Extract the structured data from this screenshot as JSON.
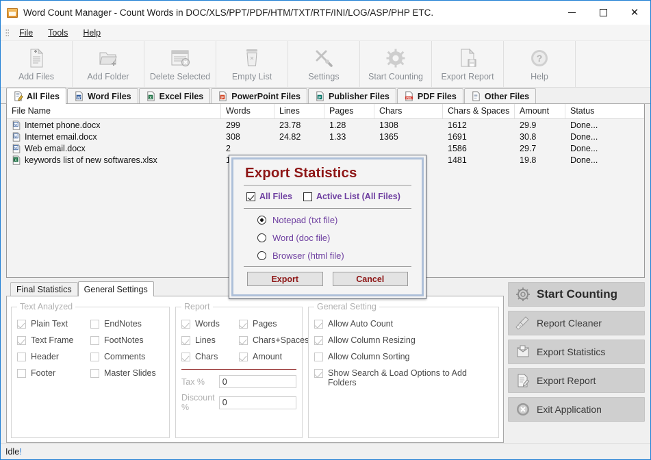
{
  "window": {
    "title": "Word Count Manager - Count Words in DOC/XLS/PPT/PDF/HTM/TXT/RTF/INI/LOG/ASP/PHP ETC.",
    "app_icon": "app-icon",
    "minimize": "–",
    "maximize": "□",
    "close": "✕"
  },
  "menu": {
    "items": [
      {
        "label": "File"
      },
      {
        "label": "Tools"
      },
      {
        "label": "Help"
      }
    ]
  },
  "toolbar": {
    "items": [
      {
        "label": "Add Files",
        "icon": "add-file-icon"
      },
      {
        "label": "Add Folder",
        "icon": "add-folder-icon"
      },
      {
        "label": "Delete Selected",
        "icon": "delete-selected-icon"
      },
      {
        "label": "Empty List",
        "icon": "trash-icon"
      },
      {
        "label": "Settings",
        "icon": "tools-icon"
      },
      {
        "label": "Start Counting",
        "icon": "gear-icon"
      },
      {
        "label": "Export Report",
        "icon": "save-document-icon"
      },
      {
        "label": "Help",
        "icon": "question-icon"
      }
    ]
  },
  "tabs": [
    {
      "label": "All Files",
      "icon": "pencil-note-icon",
      "active": true
    },
    {
      "label": "Word Files",
      "icon": "word-icon",
      "active": false
    },
    {
      "label": "Excel Files",
      "icon": "excel-icon",
      "active": false
    },
    {
      "label": "PowerPoint Files",
      "icon": "powerpoint-icon",
      "active": false
    },
    {
      "label": "Publisher Files",
      "icon": "publisher-icon",
      "active": false
    },
    {
      "label": "PDF Files",
      "icon": "pdf-icon",
      "active": false
    },
    {
      "label": "Other Files",
      "icon": "document-icon",
      "active": false
    }
  ],
  "file_list": {
    "columns": [
      "File Name",
      "Words",
      "Lines",
      "Pages",
      "Chars",
      "Chars & Spaces",
      "Amount",
      "Status"
    ],
    "rows": [
      {
        "icon": "word-file-icon",
        "name": "Internet phone.docx",
        "words": "299",
        "lines": "23.78",
        "pages": "1.28",
        "chars": "1308",
        "chars_spaces": "1612",
        "amount": "29.9",
        "status": "Done..."
      },
      {
        "icon": "word-file-icon",
        "name": "Internet email.docx",
        "words": "308",
        "lines": "24.82",
        "pages": "1.33",
        "chars": "1365",
        "chars_spaces": "1691",
        "amount": "30.8",
        "status": "Done..."
      },
      {
        "icon": "word-file-icon",
        "name": "Web email.docx",
        "words": "2",
        "lines": "",
        "pages": "",
        "chars": "",
        "chars_spaces": "1586",
        "amount": "29.7",
        "status": "Done..."
      },
      {
        "icon": "excel-file-icon",
        "name": "keywords list of new softwares.xlsx",
        "words": "1",
        "lines": "",
        "pages": "",
        "chars": "",
        "chars_spaces": "1481",
        "amount": "19.8",
        "status": "Done..."
      }
    ]
  },
  "settings": {
    "tabs": [
      {
        "label": "Final Statistics",
        "active": false
      },
      {
        "label": "General Settings",
        "active": true
      }
    ],
    "text_analyzed": {
      "legend": "Text Analyzed",
      "left": [
        {
          "label": "Plain Text",
          "checked": true
        },
        {
          "label": "Text Frame",
          "checked": true
        },
        {
          "label": "Header",
          "checked": false
        },
        {
          "label": "Footer",
          "checked": false
        }
      ],
      "right": [
        {
          "label": "EndNotes",
          "checked": false
        },
        {
          "label": "FootNotes",
          "checked": false
        },
        {
          "label": "Comments",
          "checked": false
        },
        {
          "label": "Master Slides",
          "checked": false
        }
      ]
    },
    "report": {
      "legend": "Report",
      "left": [
        {
          "label": "Words",
          "checked": true
        },
        {
          "label": "Lines",
          "checked": true
        },
        {
          "label": "Chars",
          "checked": true
        }
      ],
      "right": [
        {
          "label": "Pages",
          "checked": true
        },
        {
          "label": "Chars+Spaces",
          "checked": true
        },
        {
          "label": "Amount",
          "checked": true
        }
      ],
      "tax_label": "Tax %",
      "tax_value": "0",
      "discount_label": "Discount %",
      "discount_value": "0"
    },
    "general": {
      "legend": "General Setting",
      "items": [
        {
          "label": "Allow Auto Count",
          "checked": true
        },
        {
          "label": "Allow Column Resizing",
          "checked": true
        },
        {
          "label": "Allow Column Sorting",
          "checked": false
        },
        {
          "label": "Show Search & Load Options to Add Folders",
          "checked": true
        }
      ]
    }
  },
  "actions": [
    {
      "label": "Start Counting",
      "icon": "gear-icon",
      "primary": true
    },
    {
      "label": "Report Cleaner",
      "icon": "broom-icon",
      "primary": false
    },
    {
      "label": "Export Statistics",
      "icon": "export-stats-icon",
      "primary": false
    },
    {
      "label": "Export Report",
      "icon": "export-report-icon",
      "primary": false
    },
    {
      "label": "Exit Application",
      "icon": "exit-icon",
      "primary": false
    }
  ],
  "status": {
    "text": "Idle",
    "suffix": "!"
  },
  "dialog": {
    "title": "Export Statistics",
    "checkboxes": [
      {
        "label": "All Files",
        "checked": true
      },
      {
        "label": "Active List (All Files)",
        "checked": false
      }
    ],
    "radios": [
      {
        "label": "Notepad (txt file)",
        "selected": true
      },
      {
        "label": "Word (doc file)",
        "selected": false
      },
      {
        "label": "Browser (html file)",
        "selected": false
      }
    ],
    "export_label": "Export",
    "cancel_label": "Cancel"
  },
  "colors": {
    "accent_border": "#1f7fd4",
    "dialog_title": "#8e1616",
    "dialog_text": "#6e3fa0",
    "separator_dark_red": "#8c1b1b",
    "status_bang": "#2f7fd6"
  }
}
